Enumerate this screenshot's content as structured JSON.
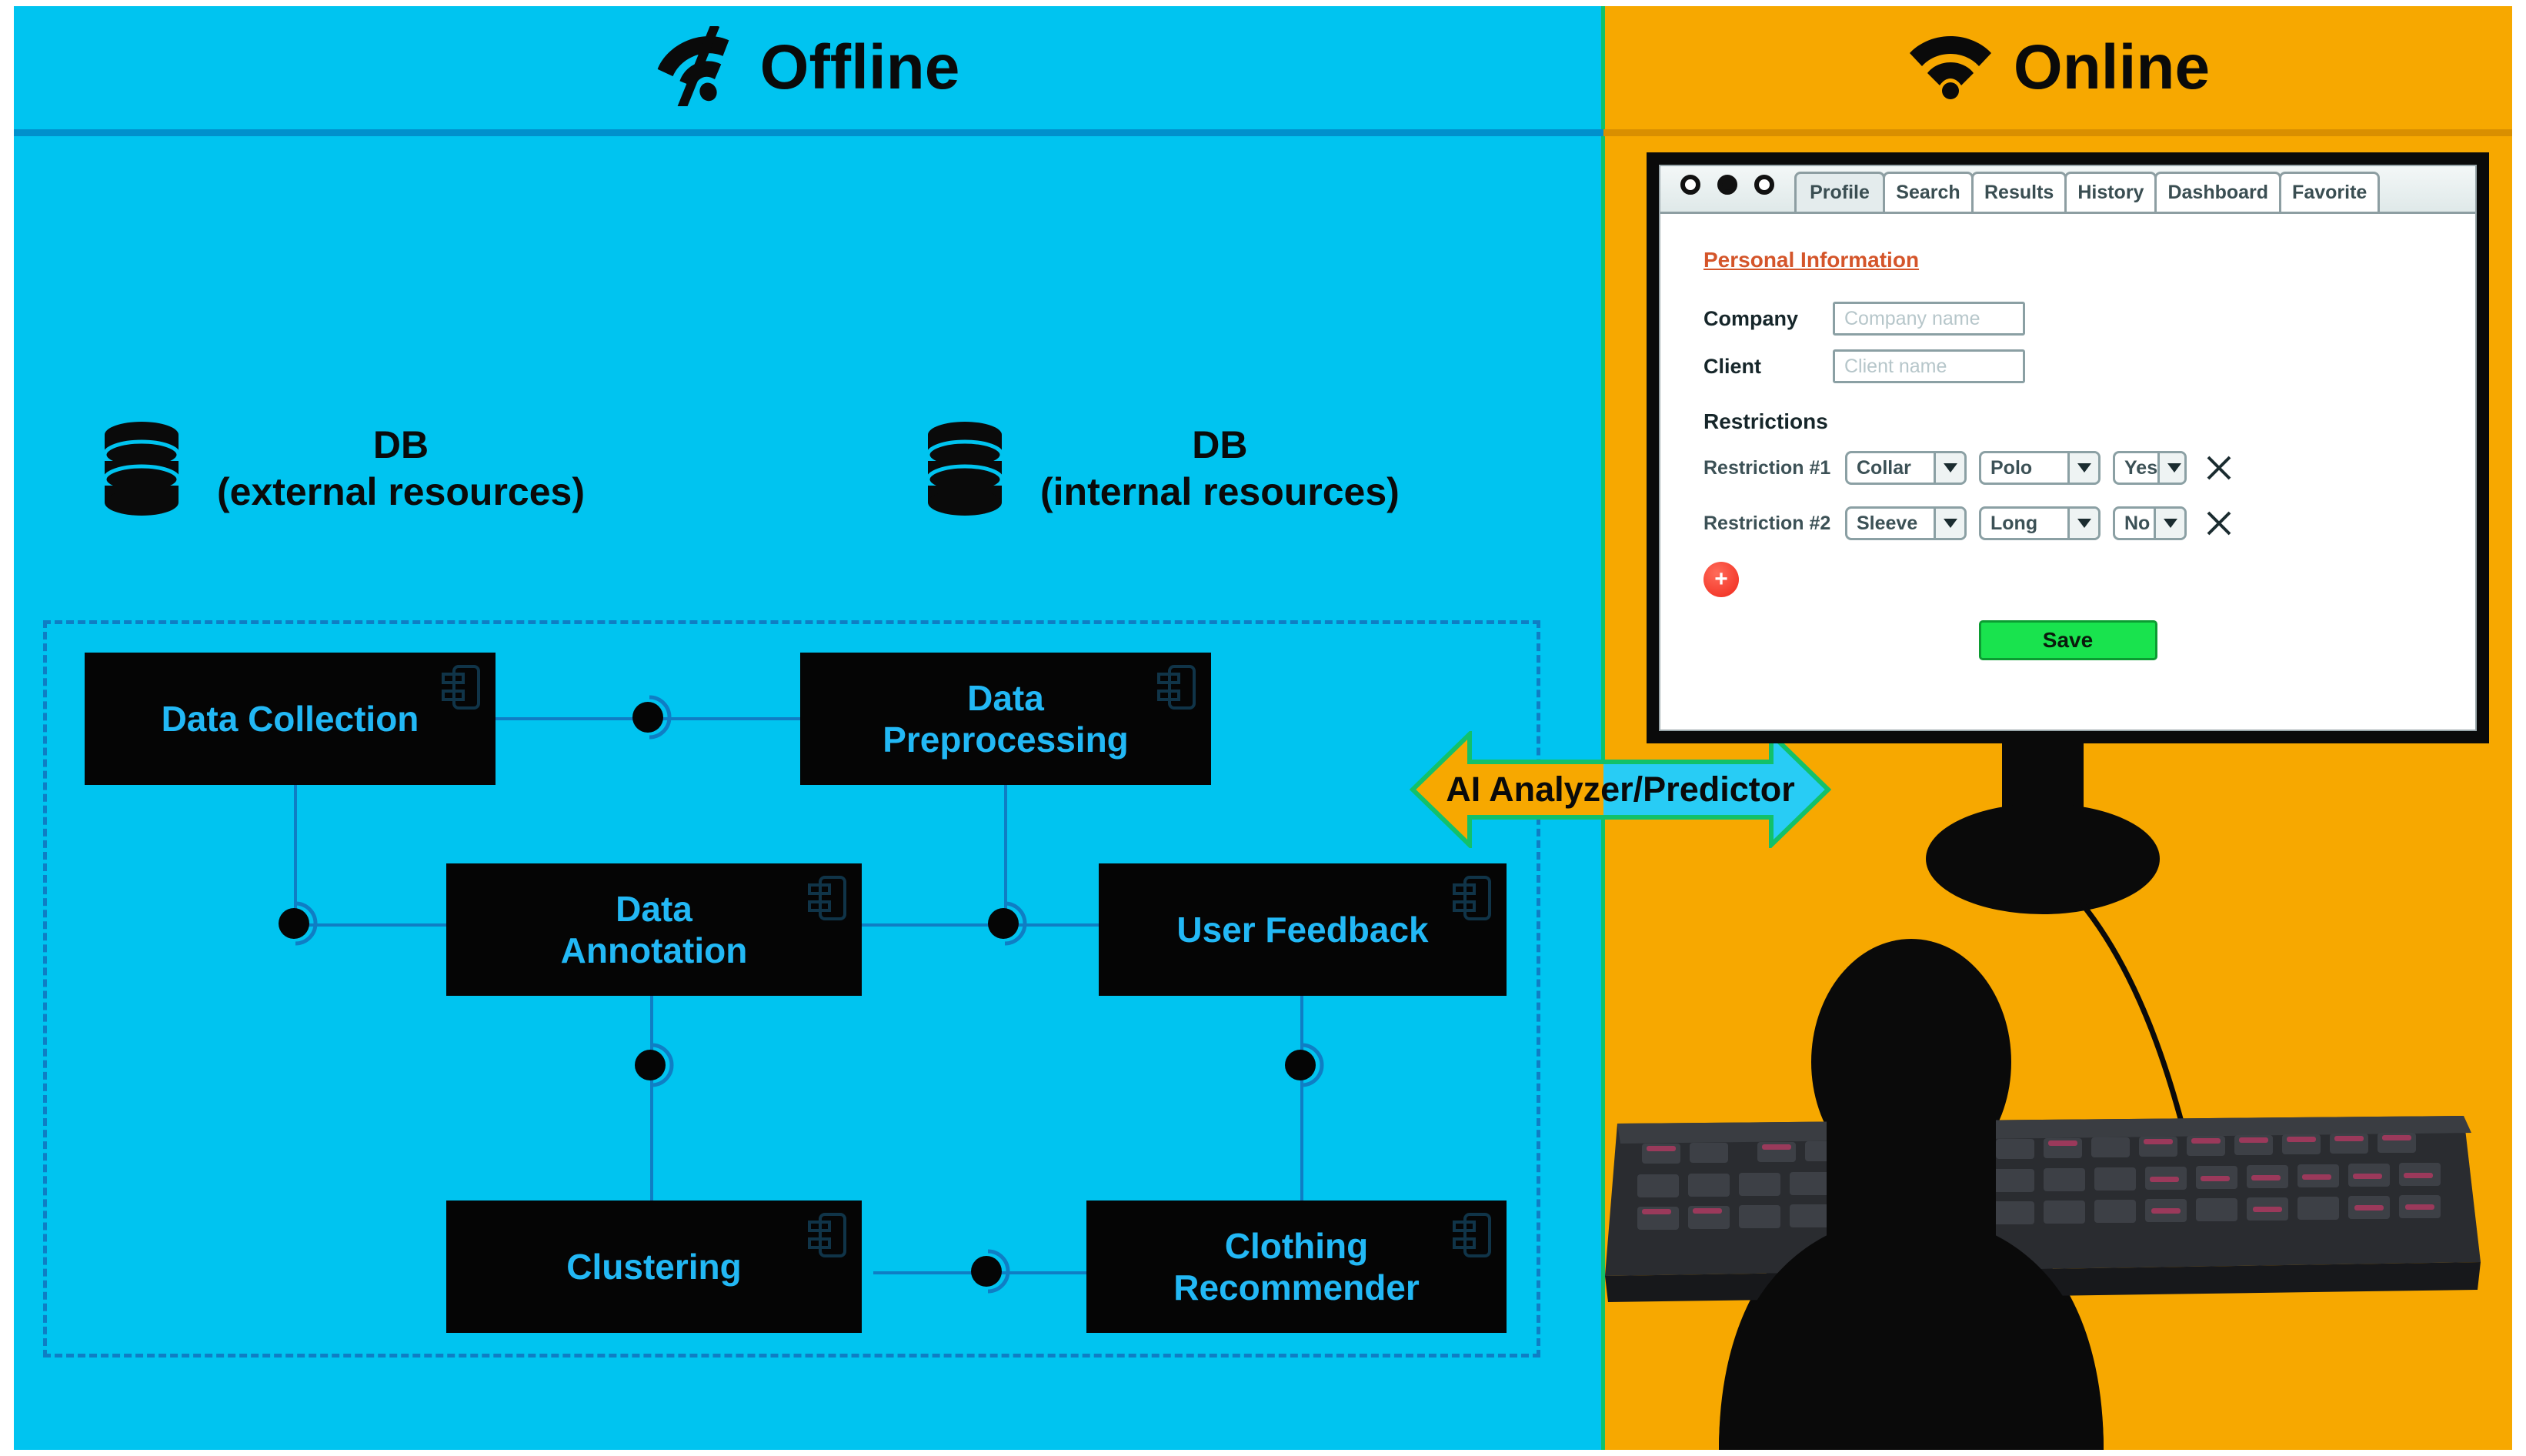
{
  "headers": {
    "offline": {
      "title": "Offline",
      "icon": "wifi-off-icon",
      "bg": "#00c4f0"
    },
    "online": {
      "title": "Online",
      "icon": "wifi-icon",
      "bg": "#f7a800"
    }
  },
  "databases": [
    {
      "name": "DB",
      "sub": "(external resources)",
      "icon": "database-icon"
    },
    {
      "name": "DB",
      "sub": "(internal resources)",
      "icon": "database-icon"
    }
  ],
  "pipeline": {
    "components": [
      {
        "id": "data-collection",
        "label": "Data Collection"
      },
      {
        "id": "data-preprocessing",
        "label_line1": "Data",
        "label_line2": "Preprocessing"
      },
      {
        "id": "data-annotation",
        "label_line1": "Data",
        "label_line2": "Annotation"
      },
      {
        "id": "user-feedback",
        "label": "User Feedback"
      },
      {
        "id": "clustering",
        "label": "Clustering"
      },
      {
        "id": "clothing-recommender",
        "label_line1": "Clothing",
        "label_line2": "Recommender"
      }
    ],
    "box_color": "#050505",
    "text_color": "#22b8f5",
    "wire_color": "#0f7ec4"
  },
  "bridge": {
    "label": "AI Analyzer/Predictor",
    "outline": "#12c16a"
  },
  "browser": {
    "window_controls": [
      "circle",
      "circle",
      "circle"
    ],
    "tabs": [
      {
        "label": "Profile",
        "active": true
      },
      {
        "label": "Search",
        "active": false
      },
      {
        "label": "Results",
        "active": false
      },
      {
        "label": "History",
        "active": false
      },
      {
        "label": "Dashboard",
        "active": false
      },
      {
        "label": "Favorite",
        "active": false
      }
    ],
    "form": {
      "section_title": "Personal Information",
      "section_title_color": "#d4552a",
      "fields": [
        {
          "label": "Company",
          "value": "",
          "placeholder": "Company name"
        },
        {
          "label": "Client",
          "value": "",
          "placeholder": "Client name"
        }
      ],
      "restrictions_title": "Restrictions",
      "restrictions": [
        {
          "label": "Restriction #1",
          "attribute": "Collar",
          "value": "Polo",
          "required": "Yes",
          "remove_icon": "close-icon"
        },
        {
          "label": "Restriction #2",
          "attribute": "Sleeve",
          "value": "Long",
          "required": "No",
          "remove_icon": "close-icon"
        }
      ],
      "add_label": "+",
      "add_color": "#f0281b",
      "save_label": "Save",
      "save_color": "#19e34e"
    }
  }
}
